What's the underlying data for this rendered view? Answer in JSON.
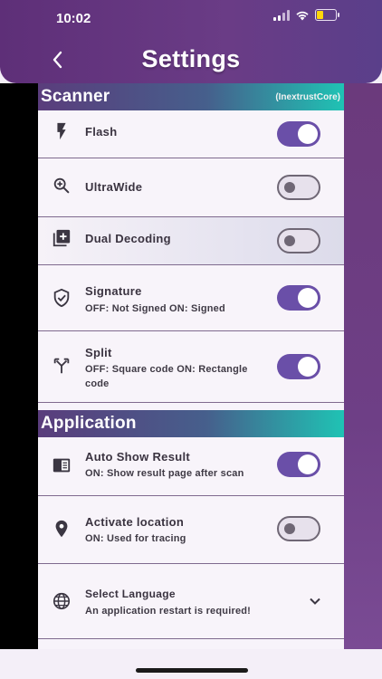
{
  "status_bar": {
    "time": "10:02"
  },
  "header": {
    "title": "Settings"
  },
  "scanner": {
    "title": "Scanner",
    "note": "(InextrustCore)",
    "items": [
      {
        "label": "Flash",
        "icon": "flash-icon",
        "toggle": true
      },
      {
        "label": "UltraWide",
        "icon": "zoom-in-icon",
        "toggle": false
      },
      {
        "label": "Dual Decoding",
        "icon": "library-add-icon",
        "toggle": false
      },
      {
        "label": "Signature",
        "sub": "OFF: Not Signed ON: Signed",
        "icon": "verified-shield-icon",
        "toggle": true
      },
      {
        "label": "Split",
        "sub": "OFF: Square code ON: Rectangle code",
        "icon": "call-split-icon",
        "toggle": true
      }
    ]
  },
  "application": {
    "title": "Application",
    "items": [
      {
        "label": "Auto Show Result",
        "sub": "ON: Show result page after scan",
        "icon": "chrome-reader-icon",
        "toggle": true
      },
      {
        "label": "Activate location",
        "sub": "ON: Used for tracing",
        "icon": "location-pin-icon",
        "toggle": false
      },
      {
        "label": "Select Language",
        "sub": "An application restart is required!",
        "icon": "globe-icon"
      }
    ]
  },
  "colors": {
    "toggle_on": "#6a4fa8",
    "header": "#5e2f78",
    "accent_teal": "#1fc3b4"
  }
}
